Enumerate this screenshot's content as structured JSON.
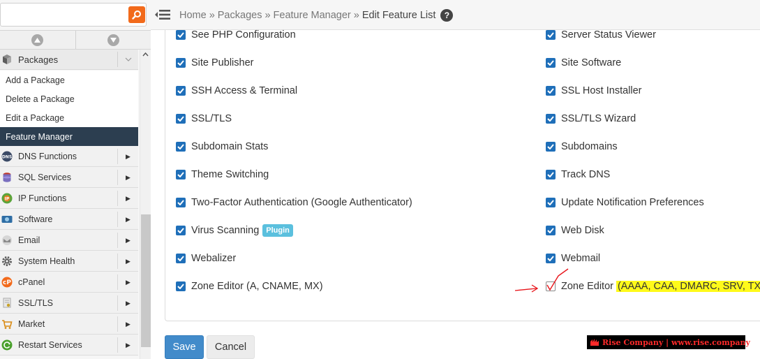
{
  "search": {
    "placeholder": "",
    "value": ""
  },
  "sidebar": {
    "section": {
      "label": "Packages"
    },
    "sub_items": [
      {
        "label": "Add a Package",
        "active": false
      },
      {
        "label": "Delete a Package",
        "active": false
      },
      {
        "label": "Edit a Package",
        "active": false
      },
      {
        "label": "Feature Manager",
        "active": true
      }
    ],
    "categories": [
      {
        "label": "DNS Functions",
        "icon": "dns-icon"
      },
      {
        "label": "SQL Services",
        "icon": "database-icon"
      },
      {
        "label": "IP Functions",
        "icon": "ip-icon"
      },
      {
        "label": "Software",
        "icon": "software-icon"
      },
      {
        "label": "Email",
        "icon": "email-icon"
      },
      {
        "label": "System Health",
        "icon": "gear-icon"
      },
      {
        "label": "cPanel",
        "icon": "cpanel-icon"
      },
      {
        "label": "SSL/TLS",
        "icon": "certificate-icon"
      },
      {
        "label": "Market",
        "icon": "cart-icon"
      },
      {
        "label": "Restart Services",
        "icon": "restart-icon"
      }
    ]
  },
  "breadcrumb": {
    "items": [
      "Home",
      "Packages",
      "Feature Manager"
    ],
    "current": "Edit Feature List",
    "separator": "»",
    "help": "?"
  },
  "features": {
    "left": [
      {
        "label": "See PHP Configuration",
        "checked": true
      },
      {
        "label": "Site Publisher",
        "checked": true
      },
      {
        "label": "SSH Access & Terminal",
        "checked": true
      },
      {
        "label": "SSL/TLS",
        "checked": true
      },
      {
        "label": "Subdomain Stats",
        "checked": true
      },
      {
        "label": "Theme Switching",
        "checked": true
      },
      {
        "label": "Two-Factor Authentication (Google Authenticator)",
        "checked": true
      },
      {
        "label": "Virus Scanning",
        "checked": true,
        "badge": "Plugin"
      },
      {
        "label": "Webalizer",
        "checked": true
      },
      {
        "label": "Zone Editor (A, CNAME, MX)",
        "checked": true
      }
    ],
    "right": [
      {
        "label": "Server Status Viewer",
        "checked": true
      },
      {
        "label": "Site Software",
        "checked": true
      },
      {
        "label": "SSL Host Installer",
        "checked": true
      },
      {
        "label": "SSL/TLS Wizard",
        "checked": true
      },
      {
        "label": "Subdomains",
        "checked": true
      },
      {
        "label": "Track DNS",
        "checked": true
      },
      {
        "label": "Update Notification Preferences",
        "checked": true
      },
      {
        "label": "Web Disk",
        "checked": true
      },
      {
        "label": "Webmail",
        "checked": true
      },
      {
        "label": "Zone Editor",
        "checked": false,
        "highlight": "(AAAA, CAA, DMARC, SRV, TXT)"
      }
    ]
  },
  "actions": {
    "save": "Save",
    "cancel": "Cancel"
  },
  "watermark": {
    "text": "Rise Company | www.rise.company"
  },
  "colors": {
    "accent": "#428bca",
    "checkbox": "#1f6fb9",
    "active_nav": "#2c3e50",
    "search_button": "#f26a1b",
    "highlight": "#fffa1a",
    "badge": "#5bc0de",
    "annotation": "#e8141a"
  }
}
